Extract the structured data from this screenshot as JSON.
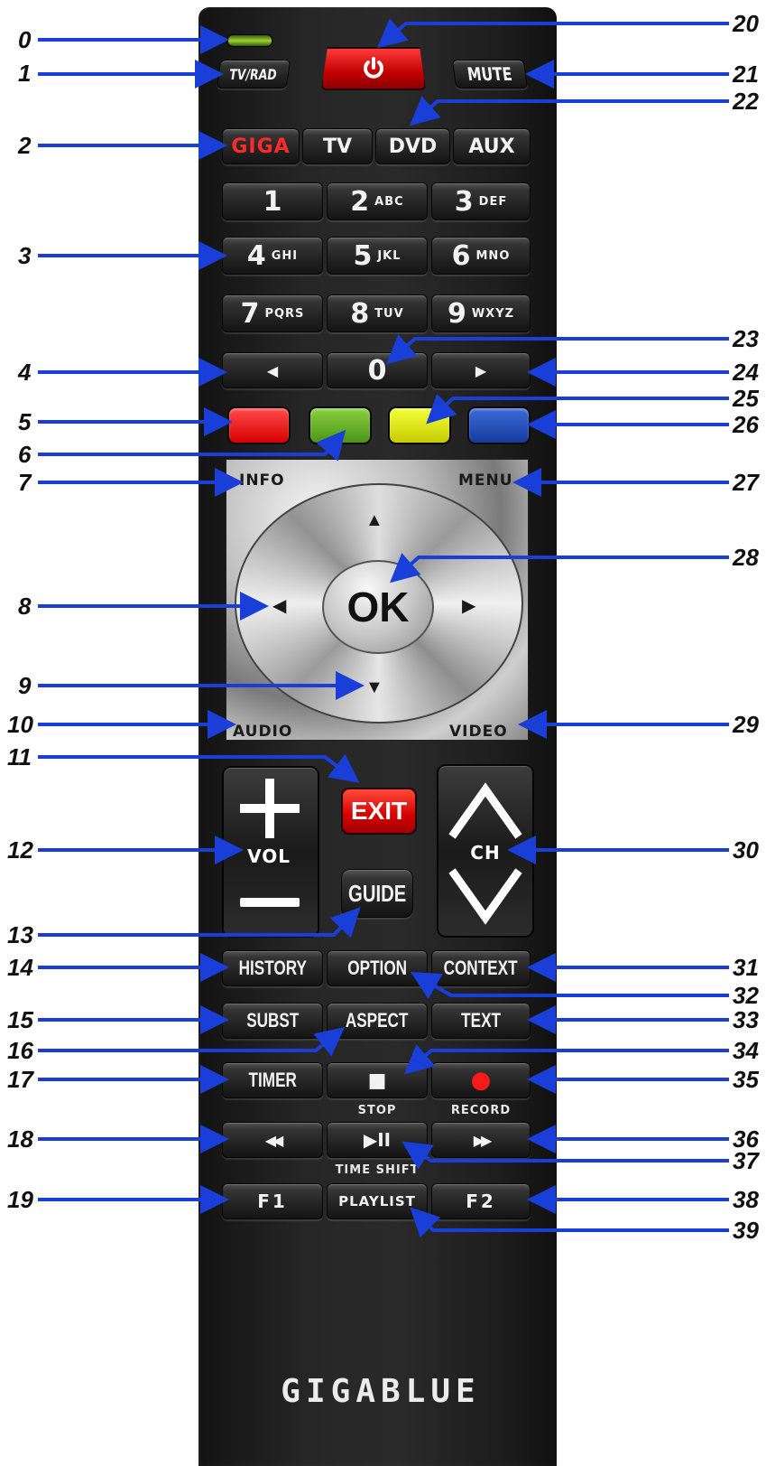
{
  "brand": "GIGABLUE",
  "callouts_left": [
    "0",
    "1",
    "2",
    "3",
    "4",
    "5",
    "6",
    "7",
    "8",
    "9",
    "10",
    "11",
    "12",
    "13",
    "14",
    "15",
    "16",
    "17",
    "18",
    "19"
  ],
  "callouts_right": [
    "20",
    "21",
    "22",
    "23",
    "24",
    "25",
    "26",
    "27",
    "28",
    "29",
    "30",
    "31",
    "32",
    "33",
    "34",
    "35",
    "36",
    "37",
    "38",
    "39"
  ],
  "top": {
    "tv_rad": "TV/RAD",
    "mute": "MUTE",
    "power_icon": "power-icon"
  },
  "source": {
    "giga": "GIGA",
    "tv": "TV",
    "dvd": "DVD",
    "aux": "AUX"
  },
  "numbers": [
    {
      "digit": "1",
      "letters": ""
    },
    {
      "digit": "2",
      "letters": "ABC"
    },
    {
      "digit": "3",
      "letters": "DEF"
    },
    {
      "digit": "4",
      "letters": "GHI"
    },
    {
      "digit": "5",
      "letters": "JKL"
    },
    {
      "digit": "6",
      "letters": "MNO"
    },
    {
      "digit": "7",
      "letters": "PQRS"
    },
    {
      "digit": "8",
      "letters": "TUV"
    },
    {
      "digit": "9",
      "letters": "WXYZ"
    }
  ],
  "row0": {
    "left": "◀",
    "zero": "0",
    "right": "▶"
  },
  "colors": {
    "red": "#e00000",
    "green": "#5aa21e",
    "yellow": "#d8e000",
    "blue": "#1a48b0",
    "accent": "#1a3fd9",
    "exit": "#e01010"
  },
  "dpad": {
    "info": "INFO",
    "menu": "MENU",
    "audio": "AUDIO",
    "video": "VIDEO",
    "ok": "OK",
    "up": "▲",
    "down": "▼",
    "left": "◀",
    "right": "▶"
  },
  "vol": {
    "plus": "+",
    "label": "VOL",
    "minus": "—"
  },
  "ch": {
    "label": "CH"
  },
  "exit": "EXIT",
  "guide": "GUIDE",
  "row_history": {
    "history": "HISTORY",
    "option": "OPTION",
    "context": "CONTEXT"
  },
  "row_subst": {
    "subst": "SUBST",
    "aspect": "ASPECT",
    "text": "TEXT"
  },
  "row_timer": {
    "timer": "TIMER",
    "stop": "■",
    "record": "●",
    "stop_label": "STOP",
    "record_label": "RECORD"
  },
  "row_media": {
    "rewind": "◀◀",
    "playpause": "▶II",
    "forward": "▶▶",
    "timeshift_label": "TIME SHIFT"
  },
  "row_f": {
    "f1": "F1",
    "playlist": "PLAYLIST",
    "f2": "F2"
  }
}
